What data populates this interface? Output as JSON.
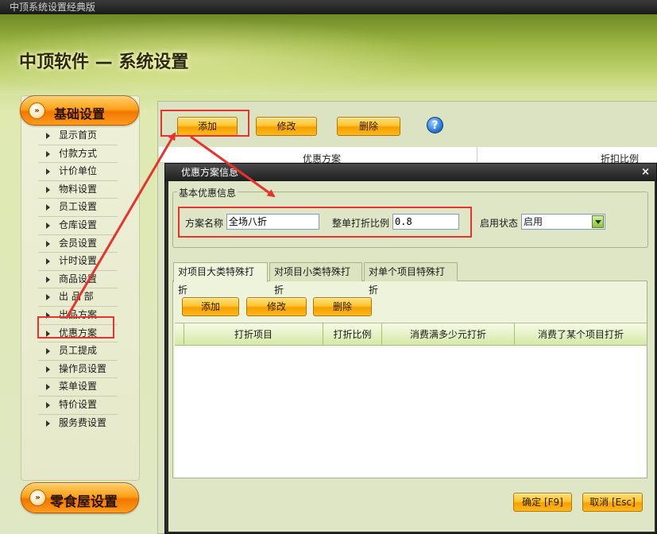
{
  "window": {
    "title": "中顶系统设置经典版"
  },
  "banner": {
    "title": "中顶软件 — 系统设置"
  },
  "sidebar": {
    "section_top": "基础设置",
    "section_bottom": "零食屋设置",
    "items": [
      {
        "label": "显示首页"
      },
      {
        "label": "付款方式"
      },
      {
        "label": "计价单位"
      },
      {
        "label": "物料设置"
      },
      {
        "label": "员工设置"
      },
      {
        "label": "仓库设置"
      },
      {
        "label": "会员设置"
      },
      {
        "label": "计时设置"
      },
      {
        "label": "商品设置"
      },
      {
        "label": "出 品 部"
      },
      {
        "label": "出品方案"
      },
      {
        "label": "优惠方案"
      },
      {
        "label": "员工提成"
      },
      {
        "label": "操作员设置"
      },
      {
        "label": "菜单设置"
      },
      {
        "label": "特价设置"
      },
      {
        "label": "服务费设置"
      }
    ]
  },
  "toolbar": {
    "add_label": "添加",
    "edit_label": "修改",
    "delete_label": "删除",
    "help_icon": "?"
  },
  "background_table": {
    "columns": [
      "优惠方案",
      "折扣比例"
    ]
  },
  "dialog": {
    "title": "优惠方案信息",
    "close_icon": "×",
    "group_title": "基本优惠信息",
    "scheme_name_label": "方案名称",
    "scheme_name_value": "全场八折",
    "ratio_label": "整单打折比例",
    "ratio_value": "0.8",
    "status_label": "启用状态",
    "status_value": "启用",
    "tabs": [
      "对项目大类特殊打折",
      "对项目小类特殊打折",
      "对单个项目特殊打折"
    ],
    "inner_toolbar": {
      "add_label": "添加",
      "edit_label": "修改",
      "delete_label": "删除"
    },
    "grid_columns": [
      "打折项目",
      "打折比例",
      "消费满多少元打折",
      "消费了某个项目打折"
    ],
    "confirm_label": "确定 [F9]",
    "cancel_label": "取消 [Esc]"
  },
  "colors": {
    "annotation": "#e8322e",
    "button_orange": "#ffc533",
    "panel_green": "#dfe6c6"
  }
}
